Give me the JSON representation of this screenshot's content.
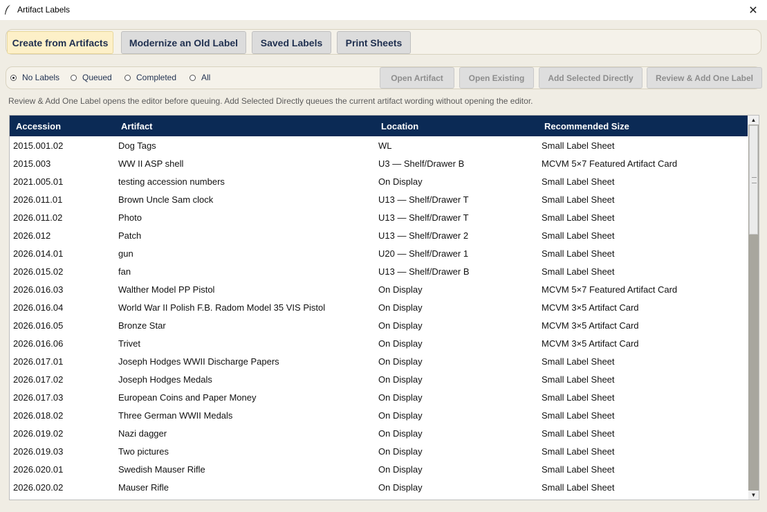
{
  "window": {
    "title": "Artifact Labels",
    "close_symbol": "✕"
  },
  "tabs": [
    {
      "label": "Create from Artifacts",
      "active": true
    },
    {
      "label": "Modernize an Old Label",
      "active": false
    },
    {
      "label": "Saved Labels",
      "active": false
    },
    {
      "label": "Print Sheets",
      "active": false
    }
  ],
  "filters": {
    "selected": "No Labels",
    "options": [
      "No Labels",
      "Queued",
      "Completed",
      "All"
    ]
  },
  "actions": {
    "open_artifact": "Open Artifact",
    "open_existing": "Open Existing",
    "add_selected_directly": "Add Selected Directly",
    "review_add_one": "Review & Add One Label"
  },
  "hint": "Review & Add One Label opens the editor before queuing. Add Selected Directly queues the current artifact wording without opening the editor.",
  "table": {
    "columns": [
      "Accession",
      "Artifact",
      "Location",
      "Recommended Size"
    ],
    "rows": [
      [
        "2015.001.02",
        "Dog Tags",
        "WL",
        "Small Label Sheet"
      ],
      [
        "2015.003",
        "WW II ASP shell",
        "U3 — Shelf/Drawer B",
        "MCVM 5×7 Featured Artifact Card"
      ],
      [
        "2021.005.01",
        "testing accession numbers",
        "On Display",
        "Small Label Sheet"
      ],
      [
        "2026.011.01",
        "Brown Uncle Sam clock",
        "U13 — Shelf/Drawer T",
        "Small Label Sheet"
      ],
      [
        "2026.011.02",
        "Photo",
        "U13 — Shelf/Drawer T",
        "Small Label Sheet"
      ],
      [
        "2026.012",
        "Patch",
        "U13 — Shelf/Drawer 2",
        "Small Label Sheet"
      ],
      [
        "2026.014.01",
        "gun",
        "U20 — Shelf/Drawer 1",
        "Small Label Sheet"
      ],
      [
        "2026.015.02",
        "fan",
        "U13 — Shelf/Drawer B",
        "Small Label Sheet"
      ],
      [
        "2026.016.03",
        "Walther Model PP Pistol",
        "On Display",
        "MCVM 5×7 Featured Artifact Card"
      ],
      [
        "2026.016.04",
        "World War II Polish F.B. Radom Model 35 VIS Pistol",
        "On Display",
        "MCVM 3×5 Artifact Card"
      ],
      [
        "2026.016.05",
        "Bronze Star",
        "On Display",
        "MCVM 3×5 Artifact Card"
      ],
      [
        "2026.016.06",
        "Trivet",
        "On Display",
        "MCVM 3×5 Artifact Card"
      ],
      [
        "2026.017.01",
        "Joseph Hodges WWII Discharge Papers",
        "On Display",
        "Small Label Sheet"
      ],
      [
        "2026.017.02",
        "Joseph Hodges Medals",
        "On Display",
        "Small Label Sheet"
      ],
      [
        "2026.017.03",
        "European Coins and Paper Money",
        "On Display",
        "Small Label Sheet"
      ],
      [
        "2026.018.02",
        "Three German WWII Medals",
        "On Display",
        "Small Label Sheet"
      ],
      [
        "2026.019.02",
        "Nazi dagger",
        "On Display",
        "Small Label Sheet"
      ],
      [
        "2026.019.03",
        "Two pictures",
        "On Display",
        "Small Label Sheet"
      ],
      [
        "2026.020.01",
        "Swedish Mauser Rifle",
        "On Display",
        "Small Label Sheet"
      ],
      [
        "2026.020.02",
        "Mauser Rifle",
        "On Display",
        "Small Label Sheet"
      ]
    ]
  },
  "colors": {
    "header_bg": "#0b2a55",
    "active_tab_bg": "#fdf0c8",
    "window_bg": "#f0ede4"
  }
}
